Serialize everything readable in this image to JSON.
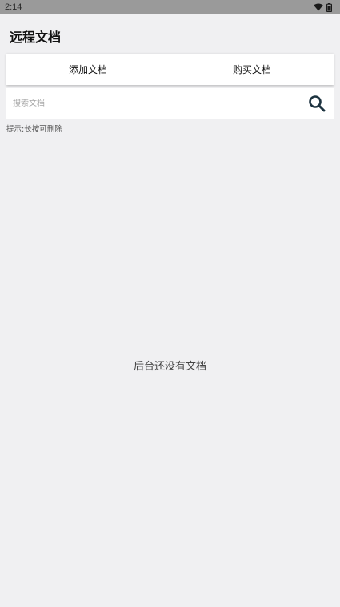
{
  "status_bar": {
    "time": "2:14",
    "icons": [
      "wifi-icon",
      "battery-icon"
    ]
  },
  "header": {
    "title": "远程文档"
  },
  "actions": {
    "add_label": "添加文档",
    "buy_label": "购买文档"
  },
  "search": {
    "placeholder": "搜索文档",
    "value": "",
    "icon": "search-icon"
  },
  "hint": "提示:长按可删除",
  "empty_state": "后台还没有文档",
  "colors": {
    "background": "#f0f0f2",
    "status_bar": "#9a9a9a",
    "card": "#ffffff",
    "search_icon": "#1d3340"
  }
}
